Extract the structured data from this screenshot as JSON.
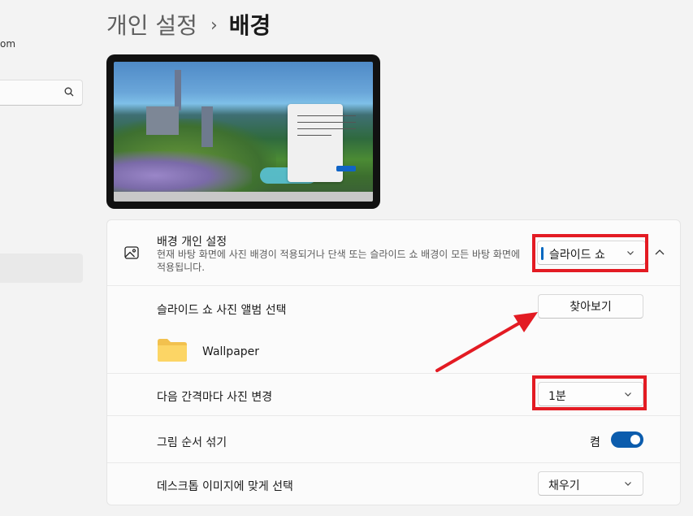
{
  "nav": {
    "account_email_fragment": "om",
    "search_icon": "search-icon"
  },
  "header": {
    "parent": "개인 설정",
    "separator": "›",
    "current": "배경"
  },
  "background": {
    "title": "배경 개인 설정",
    "description": "현재 바탕 화면에 사진 배경이 적용되거나 단색 또는 슬라이드 쇼 배경이 모든 바탕 화면에 적용됩니다.",
    "selected": "슬라이드 쇼",
    "icon": "image-icon"
  },
  "album": {
    "label": "슬라이드 쇼 사진 앨범 선택",
    "browse_button": "찾아보기",
    "folder_name": "Wallpaper",
    "folder_icon": "folder-icon"
  },
  "interval": {
    "label": "다음 간격마다 사진 변경",
    "selected": "1분"
  },
  "shuffle": {
    "label": "그림 순서 섞기",
    "state_text": "켬",
    "on": true
  },
  "fit": {
    "label": "데스크톱 이미지에 맞게 선택",
    "selected": "채우기"
  },
  "colors": {
    "accent": "#0067c0",
    "annotation": "#e31b23"
  }
}
